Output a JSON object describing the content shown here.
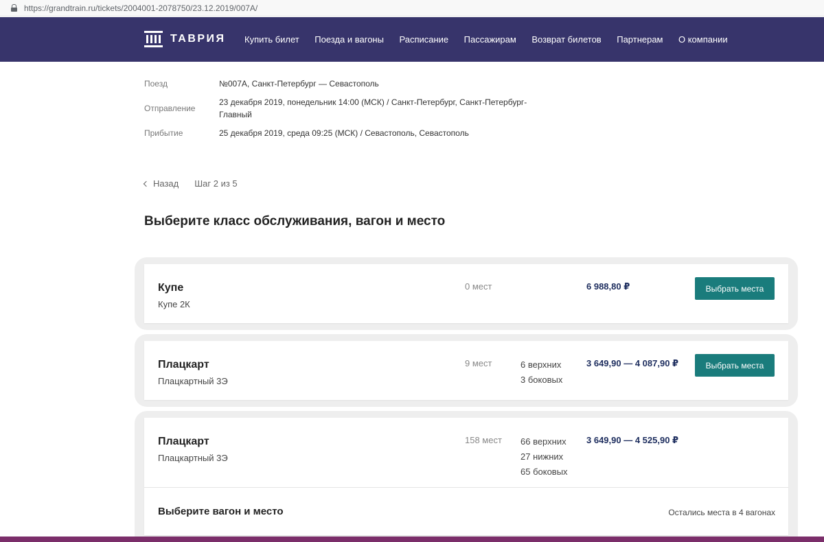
{
  "browser": {
    "url": "https://grandtrain.ru/tickets/2004001-2078750/23.12.2019/007A/"
  },
  "header": {
    "logo_text": "ТАВРИЯ",
    "menu": [
      {
        "label": "Купить билет"
      },
      {
        "label": "Поезда и вагоны"
      },
      {
        "label": "Расписание"
      },
      {
        "label": "Пассажирам"
      },
      {
        "label": "Возврат билетов"
      },
      {
        "label": "Партнерам"
      },
      {
        "label": "О компании"
      }
    ],
    "bg_color": "#37346b"
  },
  "trip": {
    "train_label": "Поезд",
    "train_value": "№007А, Санкт-Петербург — Севастополь",
    "departure_label": "Отправление",
    "departure_value": "23 декабря 2019, понедельник 14:00 (МСК) / Санкт-Петербург, Санкт-Петербург-Главный",
    "arrival_label": "Прибытие",
    "arrival_value": "25 декабря 2019, среда 09:25 (МСК) / Севастополь, Севастополь"
  },
  "steps": {
    "back_label": "Назад",
    "step_label": "Шаг 2 из 5"
  },
  "page_title": "Выберите класс обслуживания, вагон и место",
  "cars": [
    {
      "title": "Купе",
      "subtitle": "Купе 2К",
      "seats": "0 мест",
      "breakdown": [],
      "price": "6 988,80 ₽",
      "button": "Выбрать места"
    },
    {
      "title": "Плацкарт",
      "subtitle": "Плацкартный 3Э",
      "seats": "9 мест",
      "breakdown": [
        "6 верхних",
        "3 боковых"
      ],
      "price": "3 649,90 — 4 087,90 ₽",
      "button": "Выбрать места"
    },
    {
      "title": "Плацкарт",
      "subtitle": "Плацкартный 3Э",
      "seats": "158 мест",
      "breakdown": [
        "66 верхних",
        "27 нижних",
        "65 боковых"
      ],
      "price": "3 649,90 — 4 525,90 ₽"
    }
  ],
  "expanded": {
    "title": "Выберите вагон и место",
    "note": "Остались места в 4 вагонах"
  },
  "colors": {
    "accent": "#1a7c7c",
    "price": "#1d2d5e",
    "bottom_strip": "#7b2e6a"
  },
  "icons": {
    "lock": "lock-icon",
    "back": "chevron-left-icon",
    "logo": "logo-icon"
  }
}
